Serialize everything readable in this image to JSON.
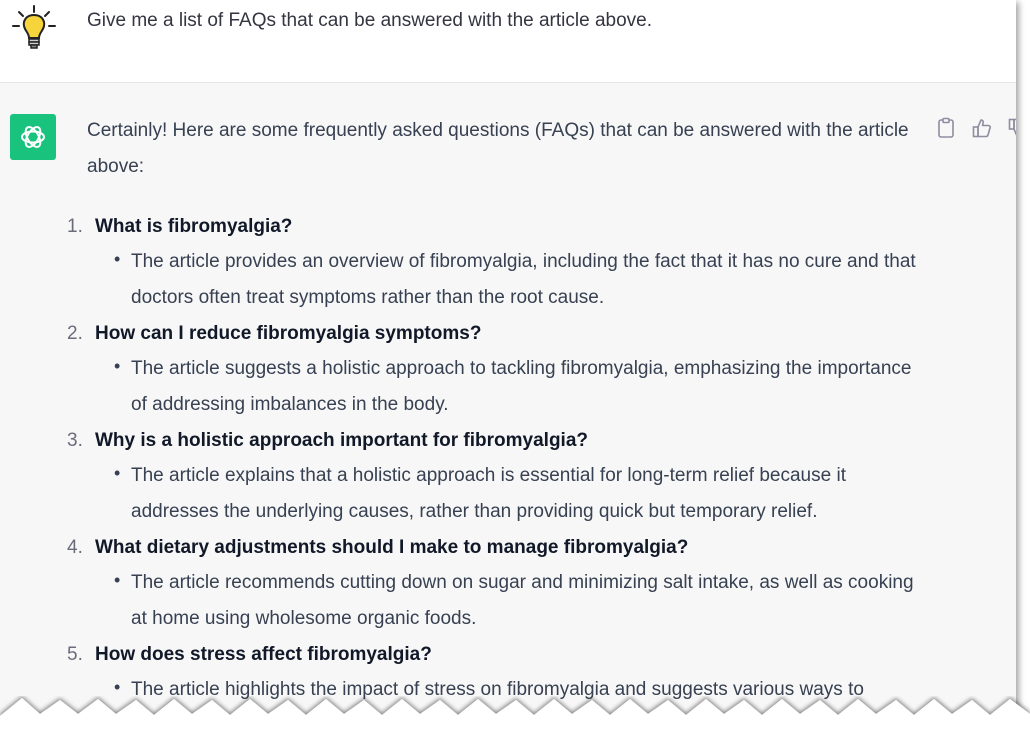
{
  "user": {
    "avatar_icon": "lightbulb-icon",
    "message": "Give me a list of FAQs that can be answered with the article above."
  },
  "assistant": {
    "avatar_icon": "openai-logo-icon",
    "accent_color": "#19c37d",
    "actions": [
      "clipboard-icon",
      "thumbs-up-icon",
      "thumbs-down-icon"
    ],
    "intro": "Certainly! Here are some frequently asked questions (FAQs) that can be answered with the article above:",
    "faqs": [
      {
        "number": "1.",
        "question": "What is fibromyalgia?",
        "answer": "The article provides an overview of fibromyalgia, including the fact that it has no cure and that doctors often treat symptoms rather than the root cause."
      },
      {
        "number": "2.",
        "question": "How can I reduce fibromyalgia symptoms?",
        "answer": "The article suggests a holistic approach to tackling fibromyalgia, emphasizing the importance of addressing imbalances in the body."
      },
      {
        "number": "3.",
        "question": "Why is a holistic approach important for fibromyalgia?",
        "answer": "The article explains that a holistic approach is essential for long-term relief because it addresses the underlying causes, rather than providing quick but temporary relief."
      },
      {
        "number": "4.",
        "question": "What dietary adjustments should I make to manage fibromyalgia?",
        "answer": "The article recommends cutting down on sugar and minimizing salt intake, as well as cooking at home using wholesome organic foods."
      },
      {
        "number": "5.",
        "question": "How does stress affect fibromyalgia?",
        "answer": "The article highlights the impact of stress on fibromyalgia and suggests various ways to"
      }
    ]
  }
}
